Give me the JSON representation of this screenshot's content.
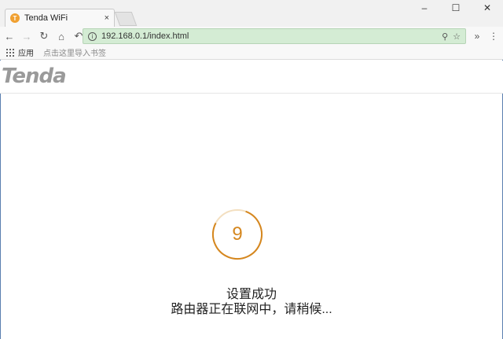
{
  "browser": {
    "tab": {
      "title": "Tenda WiFi",
      "favicon_letter": "T",
      "close": "×"
    },
    "window_controls": {
      "minimize": "–",
      "maximize": "☐",
      "close": "✕"
    },
    "toolbar": {
      "back": "←",
      "forward": "→",
      "reload": "↻",
      "home": "⌂",
      "undo": "↶",
      "info": "i",
      "url": "192.168.0.1/index.html",
      "pin": "⚲",
      "star": "☆",
      "extension": "»",
      "menu": "⋮"
    },
    "bookmarks": {
      "apps_label": "应用",
      "item": "点击这里导入书签"
    }
  },
  "page": {
    "logo": "Tenda",
    "countdown": "9",
    "status_title": "设置成功",
    "status_message": "路由器正在联网中，请稍候..."
  },
  "colors": {
    "accent": "#d5871f",
    "omnibox": "#d4ecd4"
  }
}
